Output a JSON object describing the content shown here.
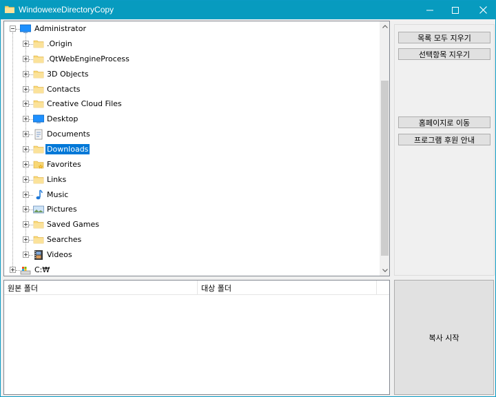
{
  "window": {
    "title": "WindowexeDirectoryCopy",
    "colors": {
      "titlebar": "#079bbf",
      "selection": "#0078d7",
      "folder": "#f8d775"
    }
  },
  "tree": {
    "root": {
      "label": "Administrator",
      "icon": "desktop-blue-icon",
      "expanded": true
    },
    "children": [
      {
        "label": ".Origin",
        "icon": "folder-icon"
      },
      {
        "label": ".QtWebEngineProcess",
        "icon": "folder-icon"
      },
      {
        "label": "3D Objects",
        "icon": "folder-icon"
      },
      {
        "label": "Contacts",
        "icon": "folder-icon"
      },
      {
        "label": "Creative Cloud Files",
        "icon": "folder-icon"
      },
      {
        "label": "Desktop",
        "icon": "desktop-blue-icon"
      },
      {
        "label": "Documents",
        "icon": "documents-icon"
      },
      {
        "label": "Downloads",
        "icon": "folder-icon",
        "selected": true
      },
      {
        "label": "Favorites",
        "icon": "favorites-folder-icon"
      },
      {
        "label": "Links",
        "icon": "folder-icon"
      },
      {
        "label": "Music",
        "icon": "music-note-icon"
      },
      {
        "label": "Pictures",
        "icon": "pictures-icon"
      },
      {
        "label": "Saved Games",
        "icon": "folder-icon"
      },
      {
        "label": "Searches",
        "icon": "folder-icon"
      },
      {
        "label": "Videos",
        "icon": "videos-icon"
      }
    ],
    "drive": {
      "label": "C:₩",
      "icon": "drive-icon"
    }
  },
  "buttons": {
    "clear_all": "목록 모두 지우기",
    "clear_selected": "선택항목 지우기",
    "homepage": "홈페이지로 이동",
    "sponsor": "프로그램 후원 안내",
    "start_copy": "복사 시작"
  },
  "list": {
    "columns": [
      "원본 폴더",
      "대상 폴더"
    ]
  }
}
